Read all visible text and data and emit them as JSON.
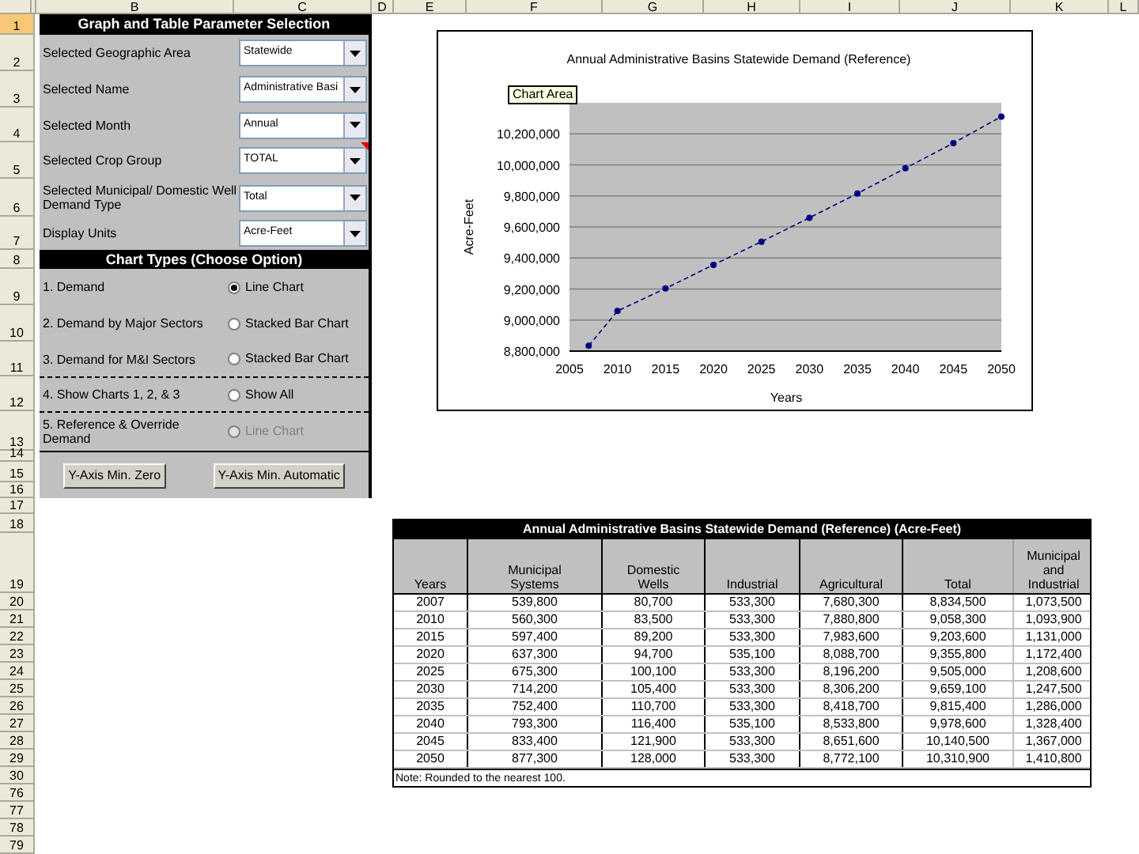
{
  "column_headers": [
    {
      "label": "B"
    },
    {
      "label": "C"
    },
    {
      "label": "D"
    },
    {
      "label": "E"
    },
    {
      "label": "F"
    },
    {
      "label": "G"
    },
    {
      "label": "H"
    },
    {
      "label": "I"
    },
    {
      "label": "J"
    },
    {
      "label": "K"
    },
    {
      "label": "L"
    }
  ],
  "row_headers": [
    {
      "label": "1",
      "selected": true
    },
    {
      "label": "2",
      "selected": false
    },
    {
      "label": "3",
      "selected": false
    },
    {
      "label": "4",
      "selected": false
    },
    {
      "label": "5",
      "selected": false
    },
    {
      "label": "6",
      "selected": false
    },
    {
      "label": "7",
      "selected": false
    },
    {
      "label": "8",
      "selected": false
    },
    {
      "label": "9",
      "selected": false
    },
    {
      "label": "10",
      "selected": false
    },
    {
      "label": "11",
      "selected": false
    },
    {
      "label": "12",
      "selected": false
    },
    {
      "label": "13",
      "selected": false
    },
    {
      "label": "14",
      "selected": false
    },
    {
      "label": "15",
      "selected": false
    },
    {
      "label": "16",
      "selected": false
    },
    {
      "label": "17",
      "selected": false
    },
    {
      "label": "18",
      "selected": false
    },
    {
      "label": "19",
      "selected": false
    },
    {
      "label": "20",
      "selected": false
    },
    {
      "label": "21",
      "selected": false
    },
    {
      "label": "22",
      "selected": false
    },
    {
      "label": "23",
      "selected": false
    },
    {
      "label": "24",
      "selected": false
    },
    {
      "label": "25",
      "selected": false
    },
    {
      "label": "26",
      "selected": false
    },
    {
      "label": "27",
      "selected": false
    },
    {
      "label": "28",
      "selected": false
    },
    {
      "label": "29",
      "selected": false
    },
    {
      "label": "30",
      "selected": false
    },
    {
      "label": "76",
      "selected": false
    },
    {
      "label": "77",
      "selected": false
    },
    {
      "label": "78",
      "selected": false
    },
    {
      "label": "79",
      "selected": false
    }
  ],
  "panel": {
    "title": "Graph and Table Parameter Selection",
    "parameters": [
      {
        "label": "Selected Geographic Area",
        "value": "Statewide",
        "has_comment": false
      },
      {
        "label": "Selected Name",
        "value": "Administrative Basi",
        "has_comment": false
      },
      {
        "label": "Selected Month",
        "value": "Annual",
        "has_comment": false
      },
      {
        "label": "Selected Crop Group",
        "value": "TOTAL",
        "has_comment": true
      },
      {
        "label": "Selected Municipal/ Domestic Well Demand Type",
        "value": "Total",
        "has_comment": false
      },
      {
        "label": "Display Units",
        "value": "Acre-Feet",
        "has_comment": false
      }
    ],
    "chart_types_title": "Chart Types (Choose Option)",
    "chart_options": [
      {
        "label": "1. Demand",
        "option": "Line Chart",
        "selected": true,
        "disabled": false
      },
      {
        "label": "2. Demand by Major Sectors",
        "option": "Stacked Bar Chart",
        "selected": false,
        "disabled": false
      },
      {
        "label": "3. Demand for M&I Sectors",
        "option": "Stacked Bar Chart",
        "selected": false,
        "disabled": false
      },
      {
        "label": "4. Show Charts 1, 2, & 3",
        "option": "Show All",
        "selected": false,
        "disabled": false
      },
      {
        "label": "5. Reference & Override Demand",
        "option": "Line Chart",
        "selected": false,
        "disabled": true
      }
    ],
    "buttons": [
      "Y-Axis Min. Zero",
      "Y-Axis Min. Automatic"
    ]
  },
  "chart": {
    "tooltip": "Chart Area",
    "chart_data": {
      "type": "line",
      "title": "Annual Administrative Basins Statewide Demand (Reference)",
      "xlabel": "Years",
      "ylabel": "Acre-Feet",
      "x": [
        2007,
        2010,
        2015,
        2020,
        2025,
        2030,
        2035,
        2040,
        2045,
        2050
      ],
      "series": [
        {
          "color": "#000080",
          "line_style": "dashed",
          "marker": "circle",
          "values": [
            8834500,
            9058300,
            9203600,
            9355800,
            9505000,
            9659100,
            9815400,
            9978600,
            10140500,
            10310900
          ]
        }
      ],
      "xlim": [
        2005,
        2050
      ],
      "ylim": [
        8800000,
        10400000
      ],
      "xticks": [
        2005,
        2010,
        2015,
        2020,
        2025,
        2030,
        2035,
        2040,
        2045,
        2050
      ],
      "yticks": [
        {
          "value": 8800000,
          "label": "8,800,000"
        },
        {
          "value": 9000000,
          "label": "9,000,000"
        },
        {
          "value": 9200000,
          "label": "9,200,000"
        },
        {
          "value": 9400000,
          "label": "9,400,000"
        },
        {
          "value": 9600000,
          "label": "9,600,000"
        },
        {
          "value": 9800000,
          "label": "9,800,000"
        },
        {
          "value": 10000000,
          "label": "10,000,000"
        },
        {
          "value": 10200000,
          "label": "10,200,000"
        }
      ],
      "grid": true
    }
  },
  "table": {
    "title": "Annual Administrative Basins Statewide Demand (Reference) (Acre-Feet)",
    "columns": [
      "Years",
      "Municipal Systems",
      "Domestic Wells",
      "Industrial",
      "Agricultural",
      "Total",
      "Municipal and Industrial"
    ],
    "rows": [
      [
        "2007",
        "539,800",
        "80,700",
        "533,300",
        "7,680,300",
        "8,834,500",
        "1,073,500"
      ],
      [
        "2010",
        "560,300",
        "83,500",
        "533,300",
        "7,880,800",
        "9,058,300",
        "1,093,900"
      ],
      [
        "2015",
        "597,400",
        "89,200",
        "533,300",
        "7,983,600",
        "9,203,600",
        "1,131,000"
      ],
      [
        "2020",
        "637,300",
        "94,700",
        "535,100",
        "8,088,700",
        "9,355,800",
        "1,172,400"
      ],
      [
        "2025",
        "675,300",
        "100,100",
        "533,300",
        "8,196,200",
        "9,505,000",
        "1,208,600"
      ],
      [
        "2030",
        "714,200",
        "105,400",
        "533,300",
        "8,306,200",
        "9,659,100",
        "1,247,500"
      ],
      [
        "2035",
        "752,400",
        "110,700",
        "533,300",
        "8,418,700",
        "9,815,400",
        "1,286,000"
      ],
      [
        "2040",
        "793,300",
        "116,400",
        "535,100",
        "8,533,800",
        "9,978,600",
        "1,328,400"
      ],
      [
        "2045",
        "833,400",
        "121,900",
        "533,300",
        "8,651,600",
        "10,140,500",
        "1,367,000"
      ],
      [
        "2050",
        "877,300",
        "128,000",
        "533,300",
        "8,772,100",
        "10,310,900",
        "1,410,800"
      ]
    ],
    "note": "Note: Rounded to the nearest 100."
  }
}
